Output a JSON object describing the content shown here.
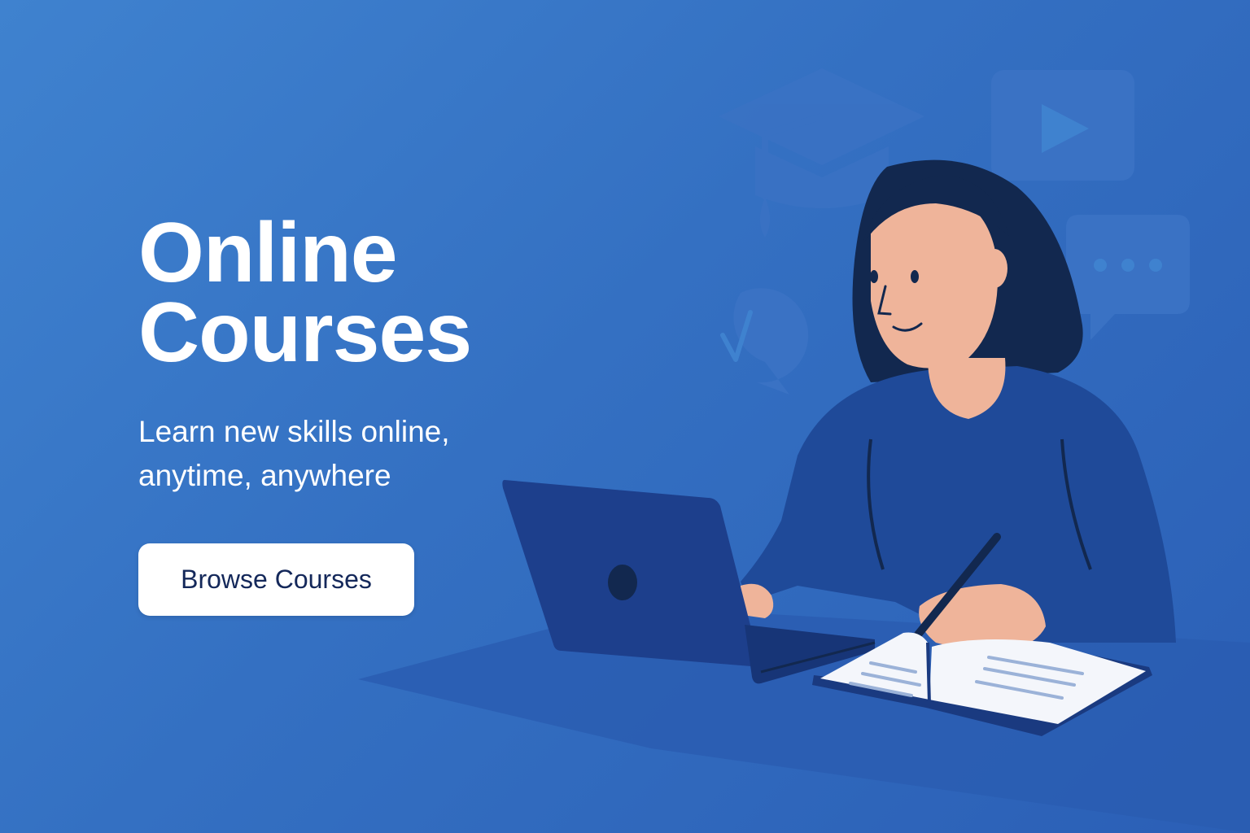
{
  "hero": {
    "title_line1": "Online",
    "title_line2": "Courses",
    "subtitle_line1": "Learn new skills online,",
    "subtitle_line2": "anytime, anywhere",
    "cta_label": "Browse Courses"
  },
  "illustration": {
    "icons": [
      "graduation-cap-icon",
      "play-video-icon",
      "chat-bubble-icon",
      "checkmark-bubble-icon"
    ],
    "figure": "person-with-laptop-and-notebook"
  },
  "colors": {
    "background": "#3470c2",
    "background_light": "#3f82cf",
    "icon_fill": "#3266b8",
    "sweater": "#1f4a99",
    "hair": "#12284f",
    "skin": "#efb49a",
    "laptop": "#1d3f8c",
    "text": "#ffffff",
    "button_text": "#14285a"
  }
}
